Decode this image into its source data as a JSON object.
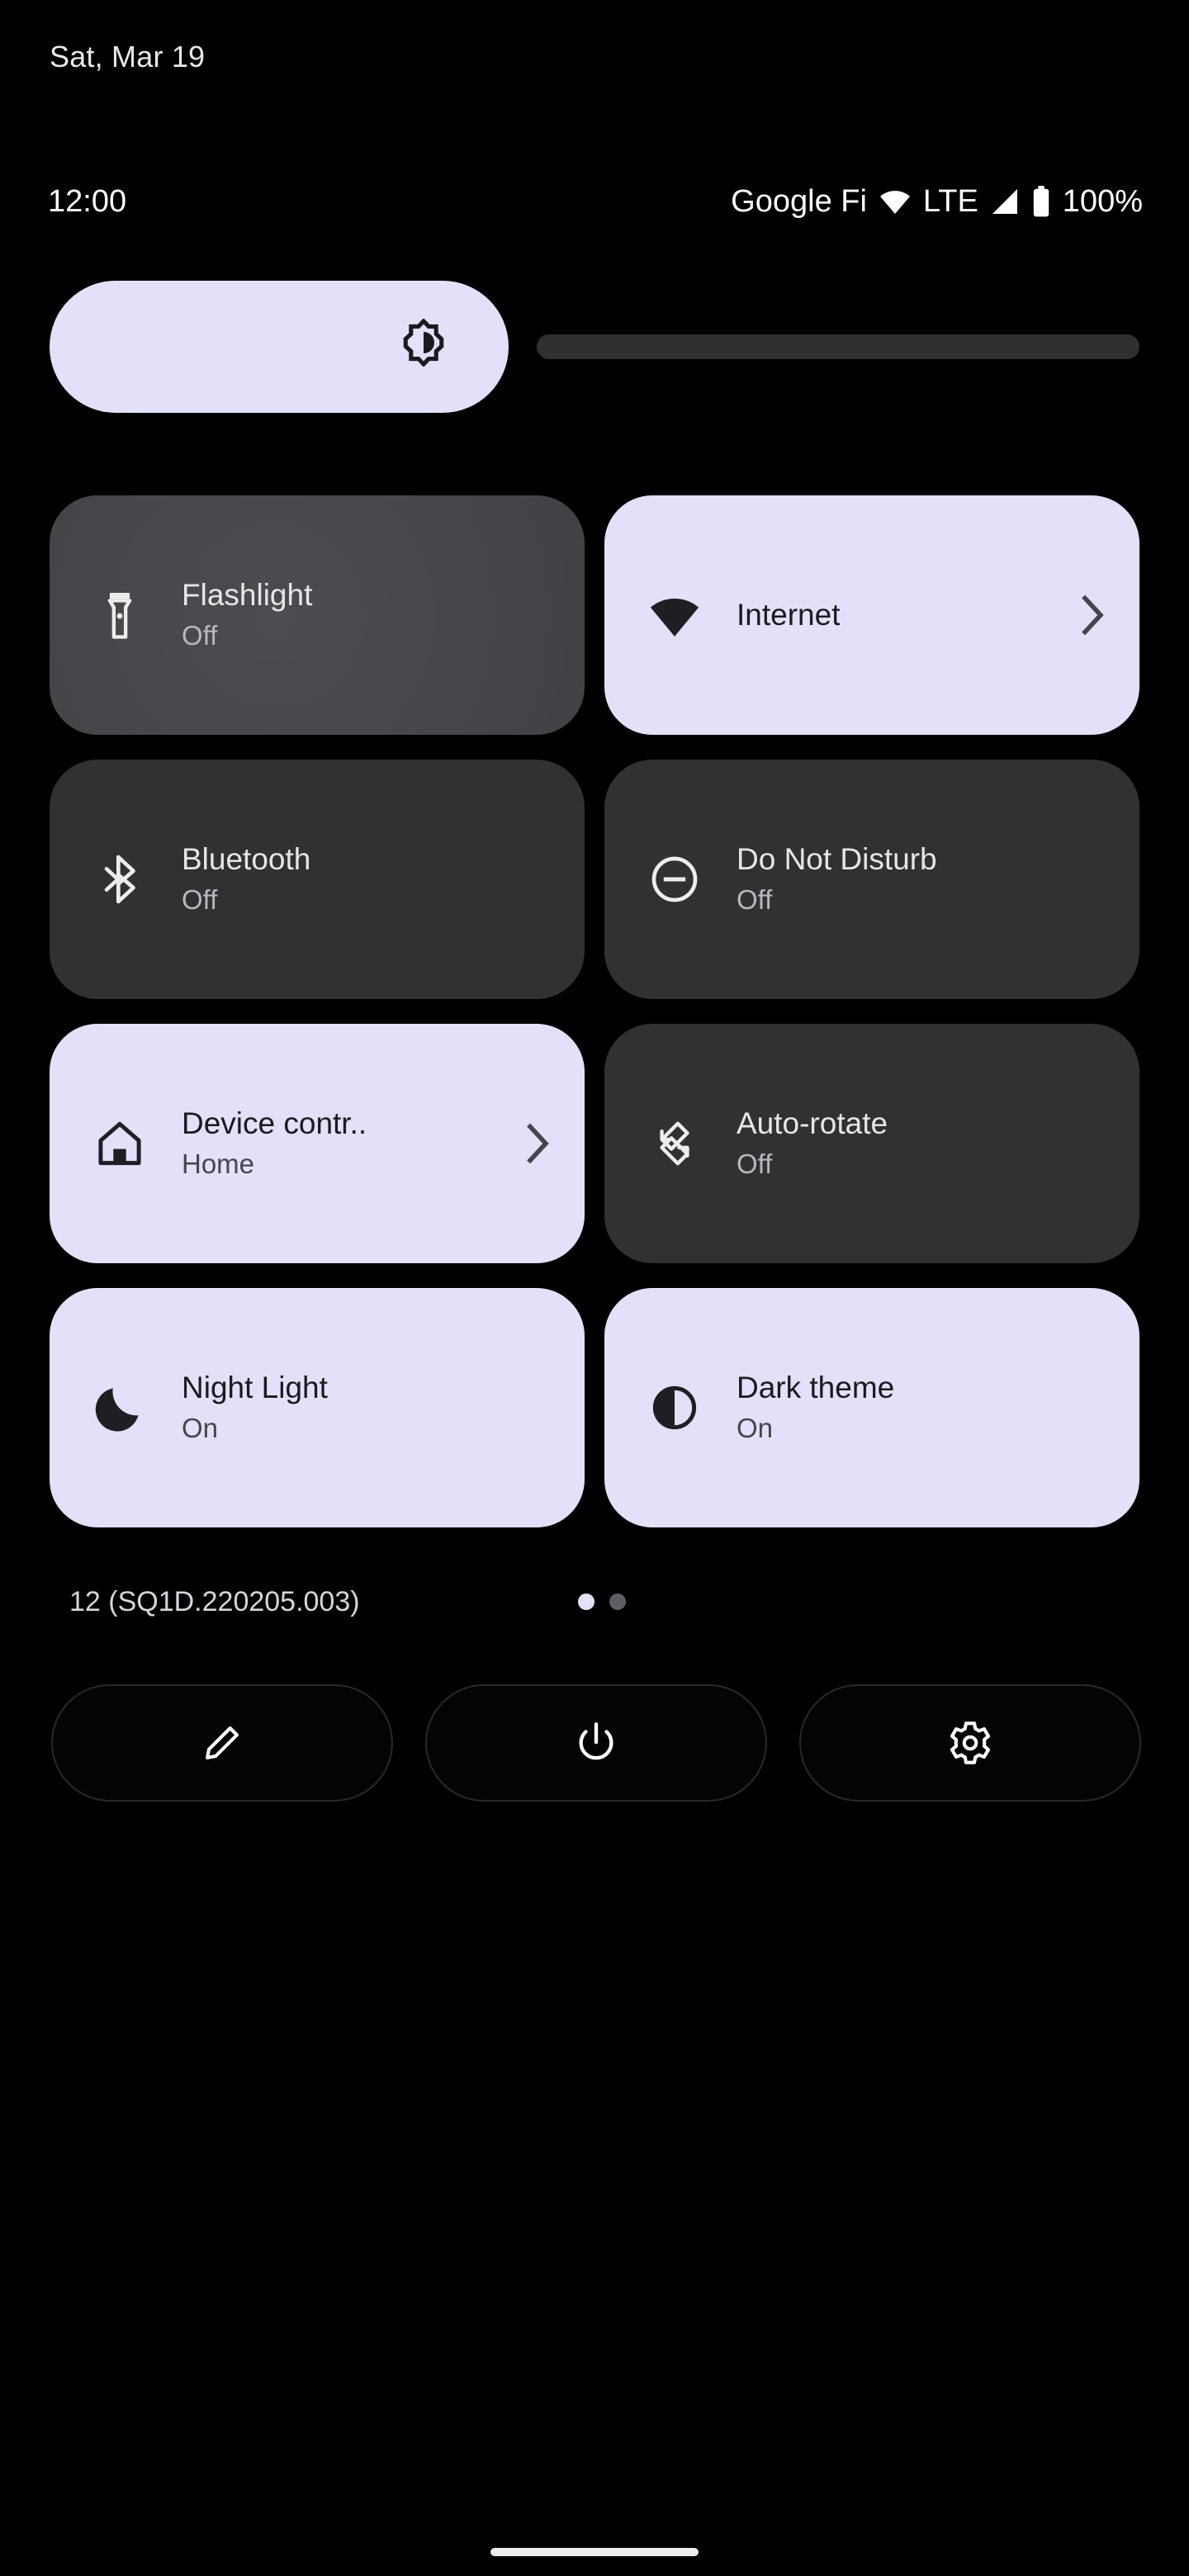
{
  "date": "Sat, Mar 19",
  "status_bar": {
    "clock": "12:00",
    "carrier": "Google Fi",
    "wifi_icon": "wifi-icon",
    "network_type": "LTE",
    "signal_icon": "signal-bars-icon",
    "battery_icon": "battery-full-icon",
    "battery_percent": "100%"
  },
  "brightness": {
    "name": "brightness-slider",
    "icon": "brightness-icon",
    "value_percent": 42
  },
  "tiles": [
    {
      "label": "Flashlight",
      "sub": "Off",
      "state": "off",
      "pressed": true,
      "icon": "flashlight-icon",
      "chevron": false
    },
    {
      "label": "Internet",
      "sub": "",
      "state": "on",
      "pressed": false,
      "icon": "wifi-icon",
      "chevron": true
    },
    {
      "label": "Bluetooth",
      "sub": "Off",
      "state": "off",
      "pressed": false,
      "icon": "bluetooth-icon",
      "chevron": false
    },
    {
      "label": "Do Not Disturb",
      "sub": "Off",
      "state": "off",
      "pressed": false,
      "icon": "do-not-disturb-icon",
      "chevron": false
    },
    {
      "label": "Device contr..",
      "sub": "Home",
      "state": "on",
      "pressed": false,
      "icon": "home-icon",
      "chevron": true
    },
    {
      "label": "Auto-rotate",
      "sub": "Off",
      "state": "off",
      "pressed": false,
      "icon": "auto-rotate-icon",
      "chevron": false
    },
    {
      "label": "Night Light",
      "sub": "On",
      "state": "on",
      "pressed": false,
      "icon": "moon-icon",
      "chevron": false
    },
    {
      "label": "Dark theme",
      "sub": "On",
      "state": "on",
      "pressed": false,
      "icon": "dark-theme-icon",
      "chevron": false
    }
  ],
  "footer": {
    "build": "12 (SQ1D.220205.003)",
    "page_dots": {
      "total": 2,
      "active_index": 0
    }
  },
  "actions": [
    {
      "name": "edit-tiles-button",
      "icon": "pencil-icon"
    },
    {
      "name": "power-button",
      "icon": "power-icon"
    },
    {
      "name": "settings-button",
      "icon": "gear-icon"
    }
  ],
  "colors": {
    "background": "#000000",
    "tile_on": "#E3E0F9",
    "tile_off": "#313134",
    "tile_pressed": "#46464A",
    "accent_text_on": "#1B1B1F",
    "text_primary": "#E6E6E8",
    "text_secondary": "#B6B6BC"
  },
  "nav": {
    "gesture_pill": "home-gesture-pill"
  }
}
